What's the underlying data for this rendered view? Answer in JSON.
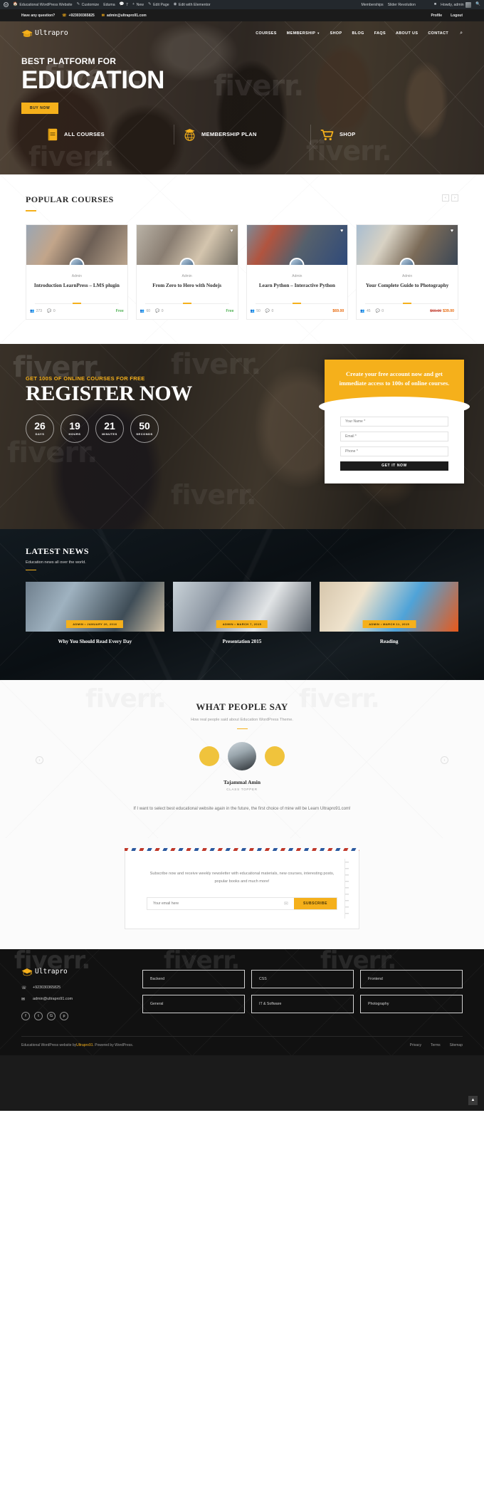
{
  "adminbar": {
    "site_name": "Educational WordPress Website",
    "items": [
      "Customize",
      "Eduma",
      "New",
      "Edit Page",
      "Edit with Elementor"
    ],
    "comments_count": "7",
    "plugins": [
      "Memberships",
      "Slider Revolution"
    ],
    "howdy": "Howdy, admin"
  },
  "topbar": {
    "question": "Have any question?",
    "phone": "+923030365825",
    "email": "admin@ultrapro91.com",
    "profile": "Profile",
    "logout": "Logout"
  },
  "header": {
    "logo": "Ultrapro",
    "menu": [
      "COURSES",
      "MEMBERSHIP",
      "SHOP",
      "BLOG",
      "FAQS",
      "ABOUT US",
      "CONTACT"
    ]
  },
  "hero": {
    "subtitle": "BEST PLATFORM FOR",
    "title": "EDUCATION",
    "cta": "BUY NOW",
    "features": [
      {
        "icon": "book-icon",
        "label": "ALL COURSES"
      },
      {
        "icon": "globe-icon",
        "label": "MEMBERSHIP PLAN"
      },
      {
        "icon": "cart-icon",
        "label": "SHOP"
      }
    ]
  },
  "popular": {
    "title": "POPULAR COURSES",
    "prev": "‹",
    "next": "›",
    "courses": [
      {
        "author": "Admin",
        "name": "Introduction LearnPress – LMS plugin",
        "students": "273",
        "comments": "0",
        "price": "Free",
        "price_type": "free",
        "old_price": ""
      },
      {
        "author": "Admin",
        "name": "From Zero to Hero with Nodejs",
        "students": "60",
        "comments": "0",
        "price": "Free",
        "price_type": "free",
        "old_price": ""
      },
      {
        "author": "Admin",
        "name": "Learn Python – Interactive Python",
        "students": "50",
        "comments": "0",
        "price": "$69.00",
        "price_type": "paid",
        "old_price": ""
      },
      {
        "author": "Admin",
        "name": "Your Complete Guide to Photography",
        "students": "45",
        "comments": "0",
        "price": "$39.00",
        "price_type": "paid",
        "old_price": "$60.00"
      }
    ]
  },
  "register": {
    "kicker_plain": "GET 100S OF ONLINE ",
    "kicker_accent": "COURSES FOR FREE",
    "title": "REGISTER NOW",
    "counter": [
      {
        "value": "26",
        "label": "DAYS"
      },
      {
        "value": "19",
        "label": "HOURS"
      },
      {
        "value": "21",
        "label": "MINUTES"
      },
      {
        "value": "50",
        "label": "SECONDS"
      }
    ],
    "card_heading": "Create your free account now and get immediate access to 100s of online courses.",
    "fields": [
      {
        "name": "your-name-field",
        "placeholder": "Your Name *"
      },
      {
        "name": "email-field",
        "placeholder": "Email *"
      },
      {
        "name": "phone-field",
        "placeholder": "Phone *"
      }
    ],
    "submit": "GET IT NOW"
  },
  "news": {
    "title": "LATEST NEWS",
    "subtitle": "Education news all over the world.",
    "posts": [
      {
        "author": "ADMIN",
        "date": "JANUARY 20, 2016",
        "title": "Why You Should Read Every Day"
      },
      {
        "author": "ADMIN",
        "date": "MARCH 7, 2015",
        "title": "Presentation 2015"
      },
      {
        "author": "ADMIN",
        "date": "MARCH 11, 2015",
        "title": "Reading"
      }
    ]
  },
  "testimonials": {
    "title": "WHAT PEOPLE SAY",
    "subtitle": "How real people said about Education WordPress Theme.",
    "name": "Tajammal Amin",
    "role": "CLASS TOPPER",
    "quote": "If I want to select best educational website again in the future, the first choice of mine will be Learn Ultrapro91.com!",
    "prev": "‹",
    "next": "›"
  },
  "newsletter": {
    "text": "Subscribe now and receive weekly newsletter with educational materials, new courses, interesting posts, popular books and much more!",
    "placeholder": "Your email here",
    "button": "SUBSCRIBE"
  },
  "footer": {
    "logo": "Ultrapro",
    "phone": "+923030365825",
    "email": "admin@ultrapro91.com",
    "social": [
      "facebook-icon",
      "twitter-icon",
      "google-plus-icon",
      "pinterest-icon"
    ],
    "categories": [
      "Backend",
      "CSS",
      "Frontend",
      "General",
      "IT & Software",
      "Photography"
    ],
    "copyright_pre": "Educational WordPress website by ",
    "copyright_brand": "Ultrapro91",
    "copyright_post": ". Powered by WordPress.",
    "links": [
      "Privacy",
      "Terms",
      "Sitemap"
    ],
    "to_top": "▲"
  },
  "colors": {
    "accent": "#f5b01b",
    "dark": "#111111",
    "free": "#4cb050",
    "paid": "#e8690b",
    "old_price": "#c0392b"
  }
}
